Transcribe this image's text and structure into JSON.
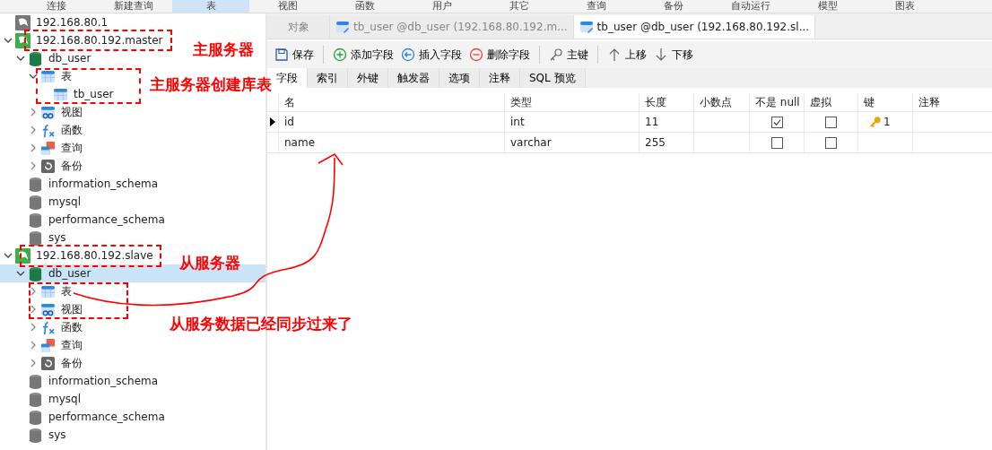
{
  "main_toolbar": [
    {
      "label": "连接",
      "selected": false
    },
    {
      "label": "新建查询",
      "selected": false
    },
    {
      "label": "表",
      "selected": true
    },
    {
      "label": "视图",
      "selected": false
    },
    {
      "label": "函数",
      "selected": false
    },
    {
      "label": "用户",
      "selected": false
    },
    {
      "label": "其它",
      "selected": false
    },
    {
      "label": "查询",
      "selected": false
    },
    {
      "label": "备份",
      "selected": false
    },
    {
      "label": "自动运行",
      "selected": false
    },
    {
      "label": "模型",
      "selected": false
    },
    {
      "label": "图表",
      "selected": false
    }
  ],
  "tree": [
    {
      "label": "192.168.80.1",
      "kind": "server",
      "connected": false,
      "selected": false
    },
    {
      "label": "192.168.80.192.master",
      "kind": "server",
      "connected": true,
      "expanded": true,
      "selected": false,
      "children": [
        {
          "label": "db_user",
          "kind": "database",
          "open": true,
          "expanded": true,
          "selected": false,
          "children": [
            {
              "label": "表",
              "kind": "table",
              "expanded": true,
              "selected": false,
              "children": [
                {
                  "label": "tb_user",
                  "kind": "table",
                  "selected": false
                }
              ]
            },
            {
              "label": "视图",
              "kind": "view",
              "expanded": false,
              "selected": false
            },
            {
              "label": "函数",
              "kind": "function",
              "expanded": false,
              "selected": false
            },
            {
              "label": "查询",
              "kind": "query",
              "expanded": false,
              "selected": false
            },
            {
              "label": "备份",
              "kind": "backup",
              "expanded": false,
              "selected": false
            }
          ]
        },
        {
          "label": "information_schema",
          "kind": "database",
          "open": false,
          "selected": false
        },
        {
          "label": "mysql",
          "kind": "database",
          "open": false,
          "selected": false
        },
        {
          "label": "performance_schema",
          "kind": "database",
          "open": false,
          "selected": false
        },
        {
          "label": "sys",
          "kind": "database",
          "open": false,
          "selected": false
        }
      ]
    },
    {
      "label": "192.168.80.192.slave",
      "kind": "server",
      "connected": true,
      "expanded": true,
      "selected": false,
      "children": [
        {
          "label": "db_user",
          "kind": "database",
          "open": true,
          "expanded": true,
          "selected": true,
          "children": [
            {
              "label": "表",
              "kind": "table",
              "expanded": false,
              "selected": false
            },
            {
              "label": "视图",
              "kind": "view",
              "expanded": false,
              "selected": false
            },
            {
              "label": "函数",
              "kind": "function",
              "expanded": false,
              "selected": false
            },
            {
              "label": "查询",
              "kind": "query",
              "expanded": false,
              "selected": false
            },
            {
              "label": "备份",
              "kind": "backup",
              "expanded": false,
              "selected": false
            }
          ]
        },
        {
          "label": "information_schema",
          "kind": "database",
          "open": false,
          "selected": false
        },
        {
          "label": "mysql",
          "kind": "database",
          "open": false,
          "selected": false
        },
        {
          "label": "performance_schema",
          "kind": "database",
          "open": false,
          "selected": false
        },
        {
          "label": "sys",
          "kind": "database",
          "open": false,
          "selected": false
        }
      ]
    }
  ],
  "editor_tabs": [
    {
      "label": "对象",
      "kind": "object",
      "selected": false
    },
    {
      "label": "tb_user @db_user (192.168.80.192.m...",
      "kind": "table",
      "selected": false
    },
    {
      "label": "tb_user @db_user (192.168.80.192.sl...",
      "kind": "table",
      "selected": true
    }
  ],
  "toolbar": [
    {
      "label": "保存",
      "kind": "save"
    },
    {
      "kind": "divider"
    },
    {
      "label": "添加字段",
      "kind": "add"
    },
    {
      "label": "插入字段",
      "kind": "insert"
    },
    {
      "label": "删除字段",
      "kind": "delete"
    },
    {
      "kind": "divider"
    },
    {
      "label": "主键",
      "kind": "key"
    },
    {
      "kind": "divider"
    },
    {
      "label": "上移",
      "kind": "up"
    },
    {
      "label": "下移",
      "kind": "down"
    }
  ],
  "sub_tabs": [
    {
      "label": "字段",
      "selected": true
    },
    {
      "label": "索引",
      "selected": false
    },
    {
      "label": "外键",
      "selected": false
    },
    {
      "label": "触发器",
      "selected": false
    },
    {
      "label": "选项",
      "selected": false
    },
    {
      "label": "注释",
      "selected": false
    },
    {
      "label": "SQL 预览",
      "selected": false
    }
  ],
  "fields_table": {
    "columns": [
      "名",
      "类型",
      "长度",
      "小数点",
      "不是 null",
      "虚拟",
      "键",
      "注释"
    ],
    "rows": [
      {
        "name": "id",
        "type": "int",
        "length": "11",
        "not_null": true,
        "virtual": false,
        "key": "1",
        "current": true
      },
      {
        "name": "name",
        "type": "varchar",
        "length": "255",
        "not_null": false,
        "virtual": false,
        "current": false
      }
    ]
  },
  "annotations": [
    {
      "text": "主服务器"
    },
    {
      "text": "主服务器创建库表"
    },
    {
      "text": "从服务器"
    },
    {
      "text": "从服务数据已经同步过来了"
    }
  ]
}
